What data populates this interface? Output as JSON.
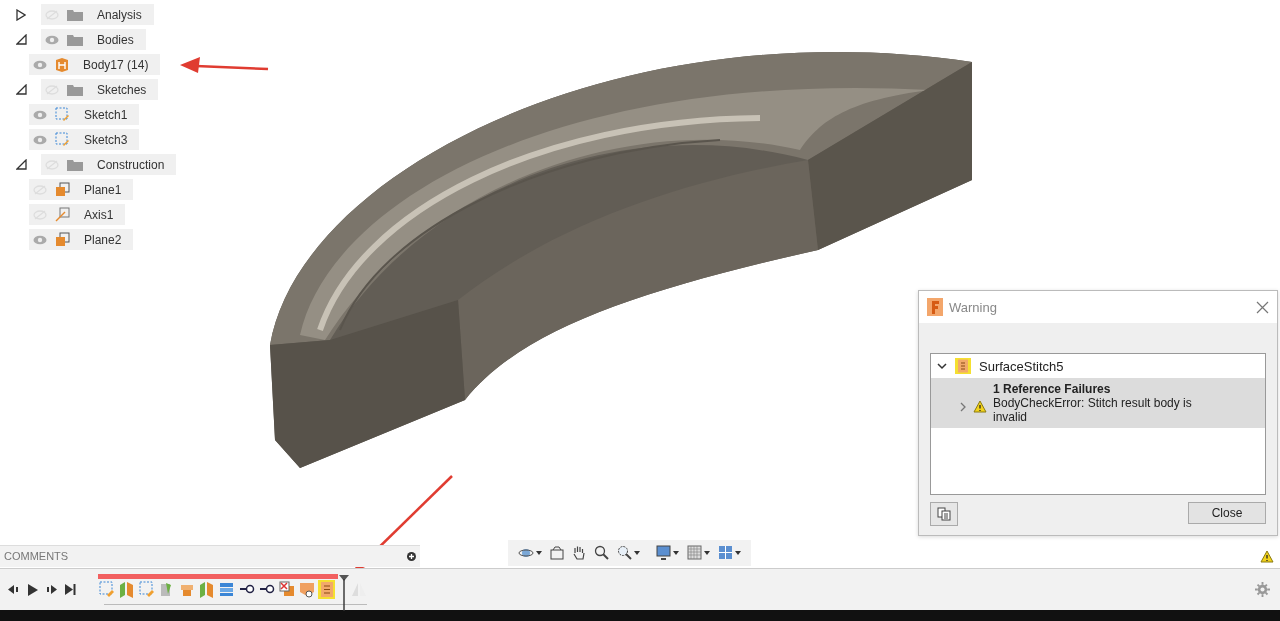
{
  "browser_tree": [
    {
      "label": "Analysis",
      "expanded": false,
      "visible": false
    },
    {
      "label": "Bodies",
      "expanded": true,
      "visible": true,
      "children": [
        {
          "label": "Body17 (14)",
          "kind": "body",
          "visible": true
        }
      ]
    },
    {
      "label": "Sketches",
      "expanded": true,
      "visible": false,
      "children": [
        {
          "label": "Sketch1",
          "kind": "sketch",
          "visible": true
        },
        {
          "label": "Sketch3",
          "kind": "sketch",
          "visible": true
        }
      ]
    },
    {
      "label": "Construction",
      "expanded": true,
      "visible": false,
      "children": [
        {
          "label": "Plane1",
          "kind": "plane",
          "visible": false
        },
        {
          "label": "Axis1",
          "kind": "axis",
          "visible": false
        },
        {
          "label": "Plane2",
          "kind": "plane",
          "visible": true
        }
      ]
    }
  ],
  "comments": {
    "label": "COMMENTS"
  },
  "warning_dialog": {
    "title": "Warning",
    "feature": {
      "label": "SurfaceStitch5",
      "expanded": true
    },
    "failure_heading": "1 Reference Failures",
    "failure_message": "BodyCheckError: Stitch result body is invalid",
    "close_button": "Close"
  },
  "timeline": [
    {
      "kind": "sketch",
      "selected": false
    },
    {
      "kind": "surface",
      "selected": false
    },
    {
      "kind": "sketch",
      "selected": false
    },
    {
      "kind": "patch",
      "selected": false
    },
    {
      "kind": "body",
      "selected": false
    },
    {
      "kind": "surface",
      "selected": false
    },
    {
      "kind": "stack",
      "selected": false
    },
    {
      "kind": "point",
      "selected": false
    },
    {
      "kind": "point",
      "selected": false
    },
    {
      "kind": "combine",
      "selected": false
    },
    {
      "kind": "shell",
      "selected": false
    },
    {
      "kind": "stitch",
      "selected": true
    },
    {
      "kind": "mirror",
      "selected": false
    }
  ]
}
